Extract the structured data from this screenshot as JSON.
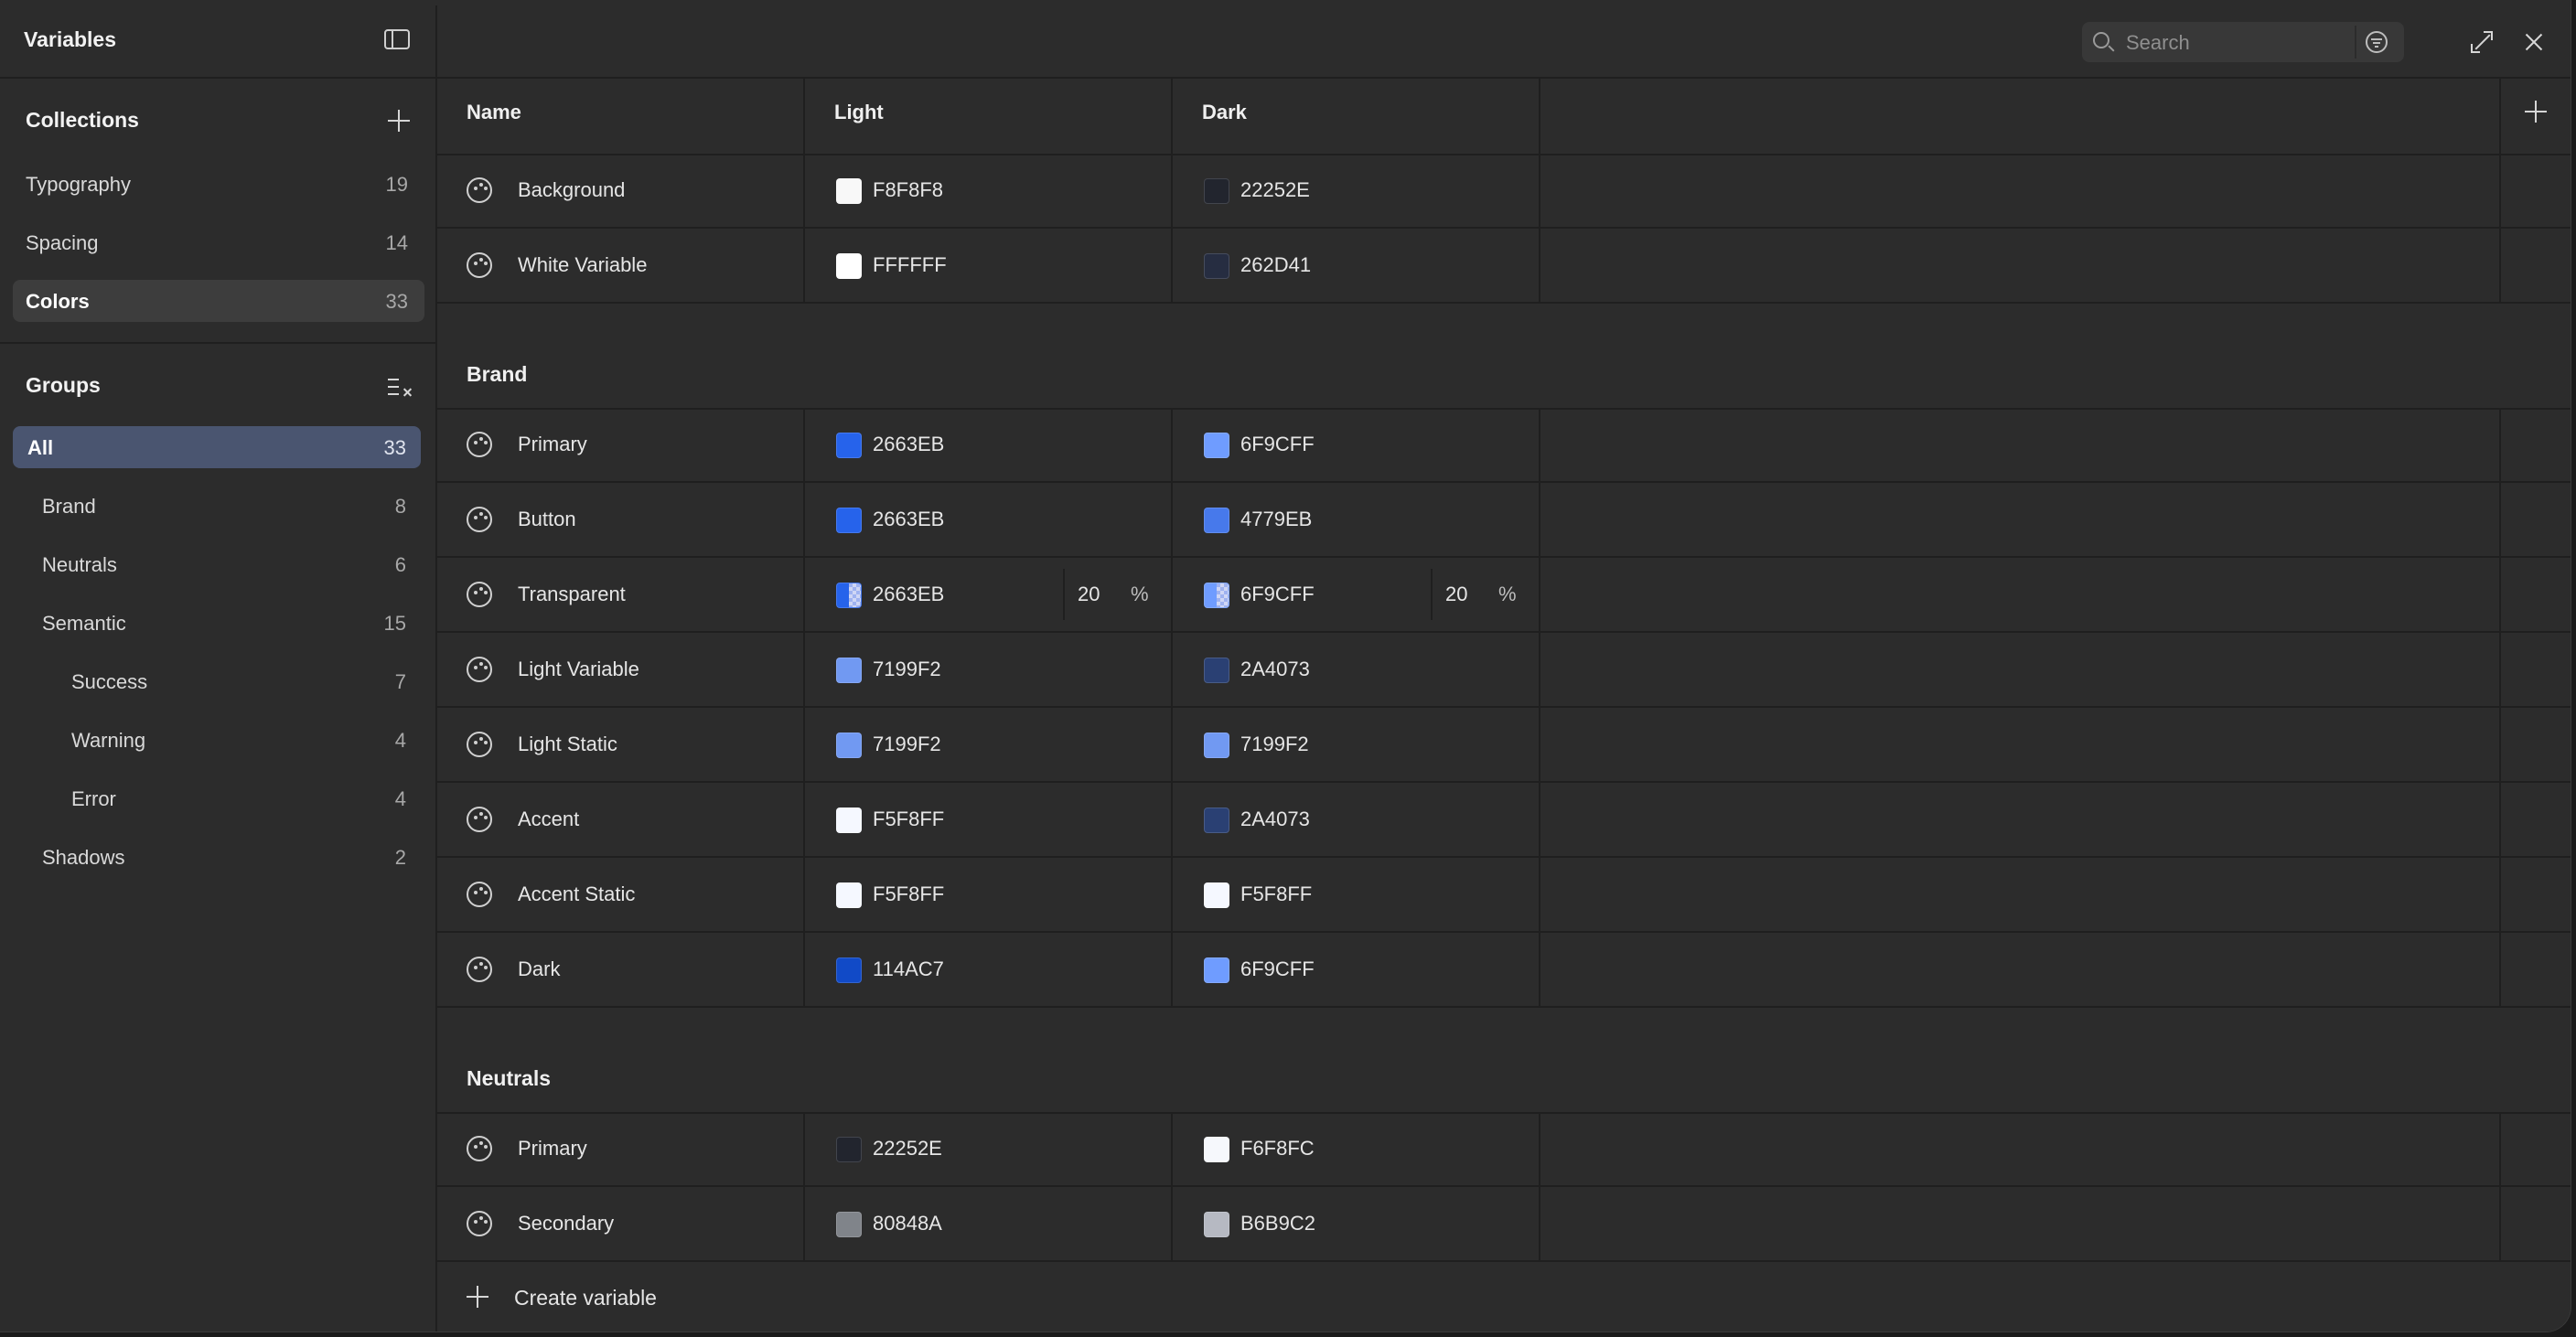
{
  "sidebar": {
    "title": "Variables",
    "collections_label": "Collections",
    "collections": [
      {
        "name": "Typography",
        "count": "19"
      },
      {
        "name": "Spacing",
        "count": "14"
      },
      {
        "name": "Colors",
        "count": "33"
      }
    ],
    "groups_label": "Groups",
    "groups": [
      {
        "name": "All",
        "count": "33"
      },
      {
        "name": "Brand",
        "count": "8"
      },
      {
        "name": "Neutrals",
        "count": "6"
      },
      {
        "name": "Semantic",
        "count": "15"
      },
      {
        "name": "Success",
        "count": "7"
      },
      {
        "name": "Warning",
        "count": "4"
      },
      {
        "name": "Error",
        "count": "4"
      },
      {
        "name": "Shadows",
        "count": "2"
      }
    ]
  },
  "toolbar": {
    "search_placeholder": "Search"
  },
  "table": {
    "columns": [
      "Name",
      "Light",
      "Dark"
    ],
    "ungrouped": [
      {
        "name": "Background",
        "light": "F8F8F8",
        "light_color": "#F8F8F8",
        "dark": "22252E",
        "dark_color": "#22252E"
      },
      {
        "name": "White Variable",
        "light": "FFFFFF",
        "light_color": "#FFFFFF",
        "dark": "262D41",
        "dark_color": "#262D41"
      }
    ],
    "brand_title": "Brand",
    "brand": [
      {
        "name": "Primary",
        "light": "2663EB",
        "light_color": "#2663EB",
        "dark": "6F9CFF",
        "dark_color": "#6F9CFF"
      },
      {
        "name": "Button",
        "light": "2663EB",
        "light_color": "#2663EB",
        "dark": "4779EB",
        "dark_color": "#4779EB"
      },
      {
        "name": "Transparent",
        "light": "2663EB",
        "light_color": "#2663EB",
        "light_opacity": "20",
        "dark": "6F9CFF",
        "dark_color": "#6F9CFF",
        "dark_opacity": "20",
        "pct": "%"
      },
      {
        "name": "Light Variable",
        "light": "7199F2",
        "light_color": "#7199F2",
        "dark": "2A4073",
        "dark_color": "#2A4073"
      },
      {
        "name": "Light Static",
        "light": "7199F2",
        "light_color": "#7199F2",
        "dark": "7199F2",
        "dark_color": "#7199F2"
      },
      {
        "name": "Accent",
        "light": "F5F8FF",
        "light_color": "#F5F8FF",
        "dark": "2A4073",
        "dark_color": "#2A4073"
      },
      {
        "name": "Accent Static",
        "light": "F5F8FF",
        "light_color": "#F5F8FF",
        "dark": "F5F8FF",
        "dark_color": "#F5F8FF"
      },
      {
        "name": "Dark",
        "light": "114AC7",
        "light_color": "#114AC7",
        "dark": "6F9CFF",
        "dark_color": "#6F9CFF"
      }
    ],
    "neutrals_title": "Neutrals",
    "neutrals": [
      {
        "name": "Primary",
        "light": "22252E",
        "light_color": "#22252E",
        "dark": "F6F8FC",
        "dark_color": "#F6F8FC"
      },
      {
        "name": "Secondary",
        "light": "80848A",
        "light_color": "#80848A",
        "dark": "B6B9C2",
        "dark_color": "#B6B9C2"
      }
    ],
    "create_label": "Create variable"
  }
}
